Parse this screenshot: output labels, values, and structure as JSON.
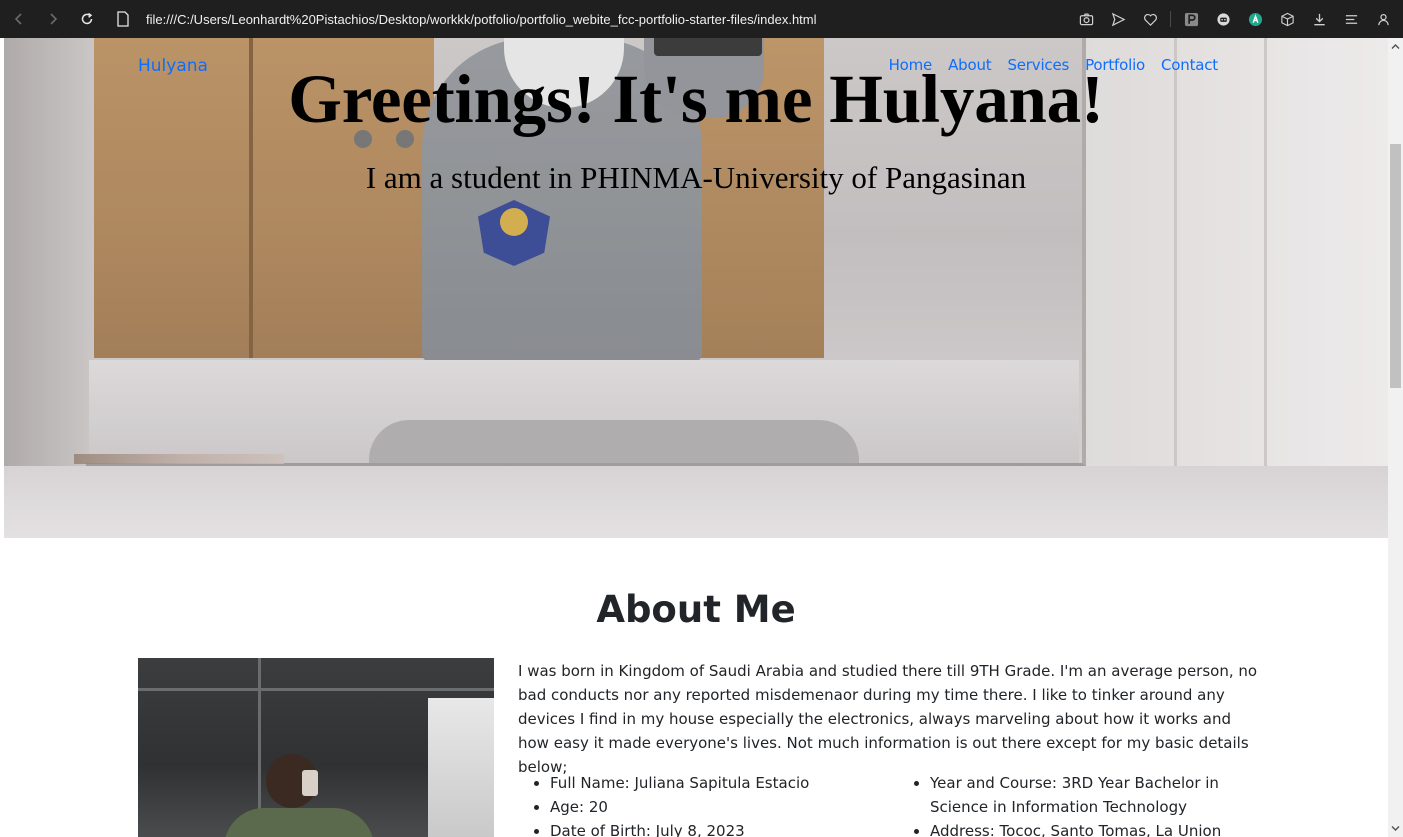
{
  "browser": {
    "url": "file:///C:/Users/Leonhardt%20Pistachios/Desktop/workkk/potfolio/portfolio_webite_fcc-portfolio-starter-files/index.html",
    "icons": [
      "back-icon",
      "forward-icon",
      "reload-icon",
      "document-icon",
      "camera-icon",
      "send-icon",
      "heart-icon",
      "extension-p-icon",
      "extension-robot-icon",
      "extension-a-icon",
      "cube-icon",
      "download-icon",
      "menu-icon",
      "profile-icon"
    ]
  },
  "site": {
    "brand": "Hulyana",
    "nav": [
      "Home",
      "About",
      "Services",
      "Portfolio",
      "Contact"
    ]
  },
  "hero": {
    "title": "Greetings! It's me Hulyana!",
    "subtitle": "I am a student in PHINMA-University of Pangasinan"
  },
  "about": {
    "title": "About Me",
    "paragraph": "I was born in Kingdom of Saudi Arabia and studied there till 9TH Grade. I'm an average person, no bad conducts nor any reported misdemenaor during my time there. I like to tinker around any devices I find in my house especially the electronics, always marveling about how it works and how easy it made everyone's lives. Not much information is out there except for my basic details below;",
    "details_left": [
      "Full Name: Juliana Sapitula Estacio",
      "Age: 20",
      "Date of Birth: July 8, 2023"
    ],
    "details_right": [
      "Year and Course: 3RD Year Bachelor in Science in Information Technology",
      "Address: Tococ, Santo Tomas, La Union"
    ]
  },
  "colors": {
    "chrome_bg": "#1f1f1f",
    "link": "#0d6efd",
    "text": "#212529"
  }
}
